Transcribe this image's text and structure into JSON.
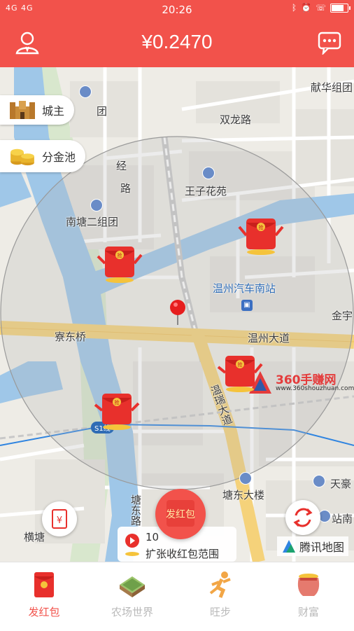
{
  "status_bar": {
    "signal": "4G 4G",
    "time": "20:26"
  },
  "header": {
    "balance": "¥0.2470",
    "user_icon": "user-icon",
    "message_icon": "message-icon"
  },
  "map": {
    "labels": {
      "xianhua": "献华组团",
      "group": "团",
      "shuanglong": "双龙路",
      "road_jing": "经",
      "road_lu": "路",
      "wangzi": "王子花苑",
      "nanyong": "南塘二组团",
      "bus_station": "温州汽车南站",
      "jinyu": "金宇",
      "liaodong": "寮东桥",
      "wenzhou_avenue": "温州大道",
      "wenrui": "温瑞大道",
      "tangdong_building": "塘东大楼",
      "tianhao": "天豪",
      "station_road": "站南",
      "hengtang": "横塘",
      "tangdong_road": "塘东路",
      "expressway": "S1线"
    },
    "chips": {
      "city_lord": "城主",
      "gold_pool": "分金池"
    },
    "expand": {
      "count": "10",
      "text": "扩张收红包范围"
    },
    "send_button": "发红包",
    "provider": "腾讯地图",
    "watermark": {
      "brand": "360手赚网",
      "url": "www.360shouzhuan.com"
    },
    "packet_label": "抢"
  },
  "tabs": [
    {
      "label": "发红包",
      "active": true
    },
    {
      "label": "农场世界",
      "active": false
    },
    {
      "label": "旺步",
      "active": false
    },
    {
      "label": "财富",
      "active": false
    }
  ],
  "colors": {
    "brand": "#f2524b",
    "map_bg": "#eeece6",
    "water": "#9fc7e8",
    "highway": "#f5d27a"
  }
}
